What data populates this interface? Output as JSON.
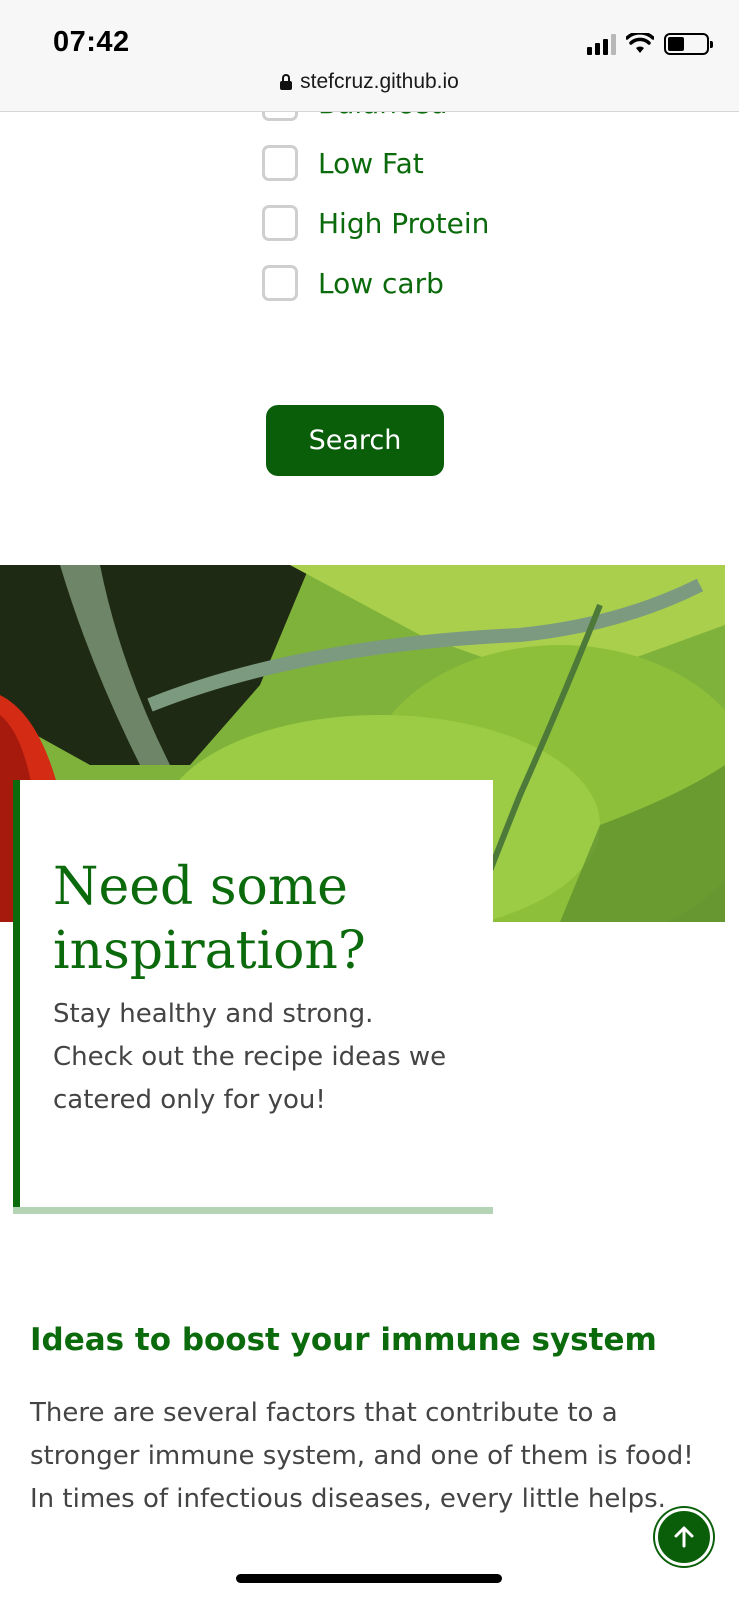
{
  "status_bar": {
    "time": "07:42"
  },
  "browser": {
    "url": "stefcruz.github.io"
  },
  "filters": {
    "options": [
      {
        "label": "Balanced",
        "checked": false
      },
      {
        "label": "Low Fat",
        "checked": false
      },
      {
        "label": "High Protein",
        "checked": false
      },
      {
        "label": "Low carb",
        "checked": false
      }
    ],
    "search_label": "Search"
  },
  "inspiration": {
    "title": "Need some inspiration?",
    "text": "Stay healthy and strong. Check out the recipe ideas we catered only for you!"
  },
  "ideas": {
    "title": "Ideas to boost your immune system",
    "text": "There are several factors that contribute to a stronger immune system, and one of them is food! In times of infectious diseases, every little helps."
  },
  "colors": {
    "brand_green": "#0b6a0b",
    "button_green": "#0a5e0a",
    "accent_light_green": "#b5d3b5"
  }
}
